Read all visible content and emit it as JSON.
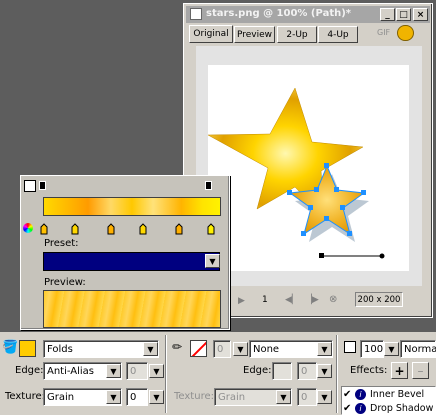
{
  "window": {
    "title": "stars.png @ 100% (Path)*",
    "buttons": [
      "_",
      "□",
      "×"
    ],
    "tabs": [
      "Original",
      "Preview",
      "2-Up",
      "4-Up"
    ],
    "format": "GIF"
  },
  "status": {
    "frame": "1",
    "size": "200 x 200"
  },
  "fill_panel": {
    "preset_label": "Preset:",
    "preset_value": "",
    "preview_label": "Preview:"
  },
  "propbar": {
    "fill_type": "Folds",
    "edge_label": "Edge:",
    "edge_value": "Anti-Alias",
    "edge_amount": "0",
    "texture_label": "Texture:",
    "texture_value": "Grain",
    "texture_amount": "0",
    "stroke_amount": "0",
    "stroke_type": "None",
    "stroke_edge_label": "Edge:",
    "stroke_edge_amount": "0",
    "stroke_texture_label": "Texture:",
    "stroke_texture_value": "Grain",
    "stroke_texture_amount": "0",
    "opacity": "100",
    "blend_mode": "Normal",
    "effects_label": "Effects:",
    "add_effect": "+",
    "remove_effect": "–",
    "effects": [
      {
        "name": "Inner Bevel",
        "info": "i"
      },
      {
        "name": "Drop Shadow",
        "info": "i"
      }
    ]
  },
  "colors": {
    "accent_fill": "#ffcc00",
    "stroke_color": "#ff0000",
    "selection": "#1e90ff",
    "preset_bg": "#000080"
  }
}
